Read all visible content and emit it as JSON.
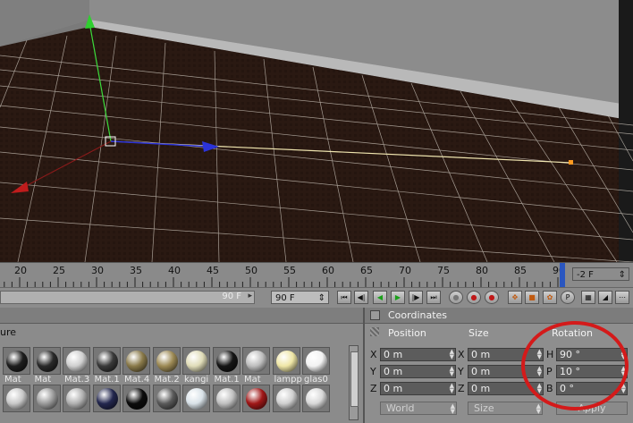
{
  "timeline": {
    "ticks": [
      "20",
      "25",
      "30",
      "35",
      "40",
      "45",
      "50",
      "55",
      "60",
      "65",
      "70",
      "75",
      "80",
      "85",
      "90"
    ],
    "current_frame": "-2 F"
  },
  "transport": {
    "frame_readout": "90 F",
    "end_frame": "90 F"
  },
  "materials": {
    "header_fragment": "ure",
    "row1": [
      {
        "label": "Mat",
        "color": "#1e1e1e"
      },
      {
        "label": "Mat",
        "color": "#2a2a2a"
      },
      {
        "label": "Mat.3",
        "color": "#cfcfcf"
      },
      {
        "label": "Mat.1",
        "color": "#3a3a3a"
      },
      {
        "label": "Mat.4",
        "color": "#8a7a4a"
      },
      {
        "label": "Mat.2",
        "color": "#9d8a55"
      },
      {
        "label": "kangi",
        "color": "#e0dcb8"
      },
      {
        "label": "Mat.1",
        "color": "#151515"
      },
      {
        "label": "Mat",
        "color": "#bdbdbd"
      },
      {
        "label": "lampp",
        "color": "#efe6a6"
      },
      {
        "label": "glas0",
        "color": "#f2f2f2"
      }
    ],
    "row2": [
      {
        "color": "#c8c8c8"
      },
      {
        "color": "#9a9a9a"
      },
      {
        "color": "#b0b0b0"
      },
      {
        "color": "#23274e"
      },
      {
        "color": "#0c0c0c"
      },
      {
        "color": "#5a5a5a"
      },
      {
        "color": "#d9e2e8"
      },
      {
        "color": "#c0c0c0"
      },
      {
        "color": "#a01818"
      },
      {
        "color": "#cfcfcf"
      },
      {
        "color": "#d8d8d8"
      }
    ]
  },
  "coordinates": {
    "title": "Coordinates",
    "headers": {
      "position": "Position",
      "size": "Size",
      "rotation": "Rotation"
    },
    "rows": [
      {
        "axis": "X",
        "position": "0 m",
        "size_axis": "X",
        "size": "0 m",
        "rot_axis": "H",
        "rotation": "90 °"
      },
      {
        "axis": "Y",
        "position": "0 m",
        "size_axis": "Y",
        "size": "0 m",
        "rot_axis": "P",
        "rotation": "10 °"
      },
      {
        "axis": "Z",
        "position": "0 m",
        "size_axis": "Z",
        "size": "0 m",
        "rot_axis": "B",
        "rotation": "0 °"
      }
    ],
    "space_select": "World",
    "size_select": "Size",
    "apply_label": "Apply"
  },
  "colors": {
    "highlight_ring": "#d41a1a",
    "floor": "#2b1a12",
    "grid": "#d8d2c8",
    "wall": "#8f8f8f"
  }
}
